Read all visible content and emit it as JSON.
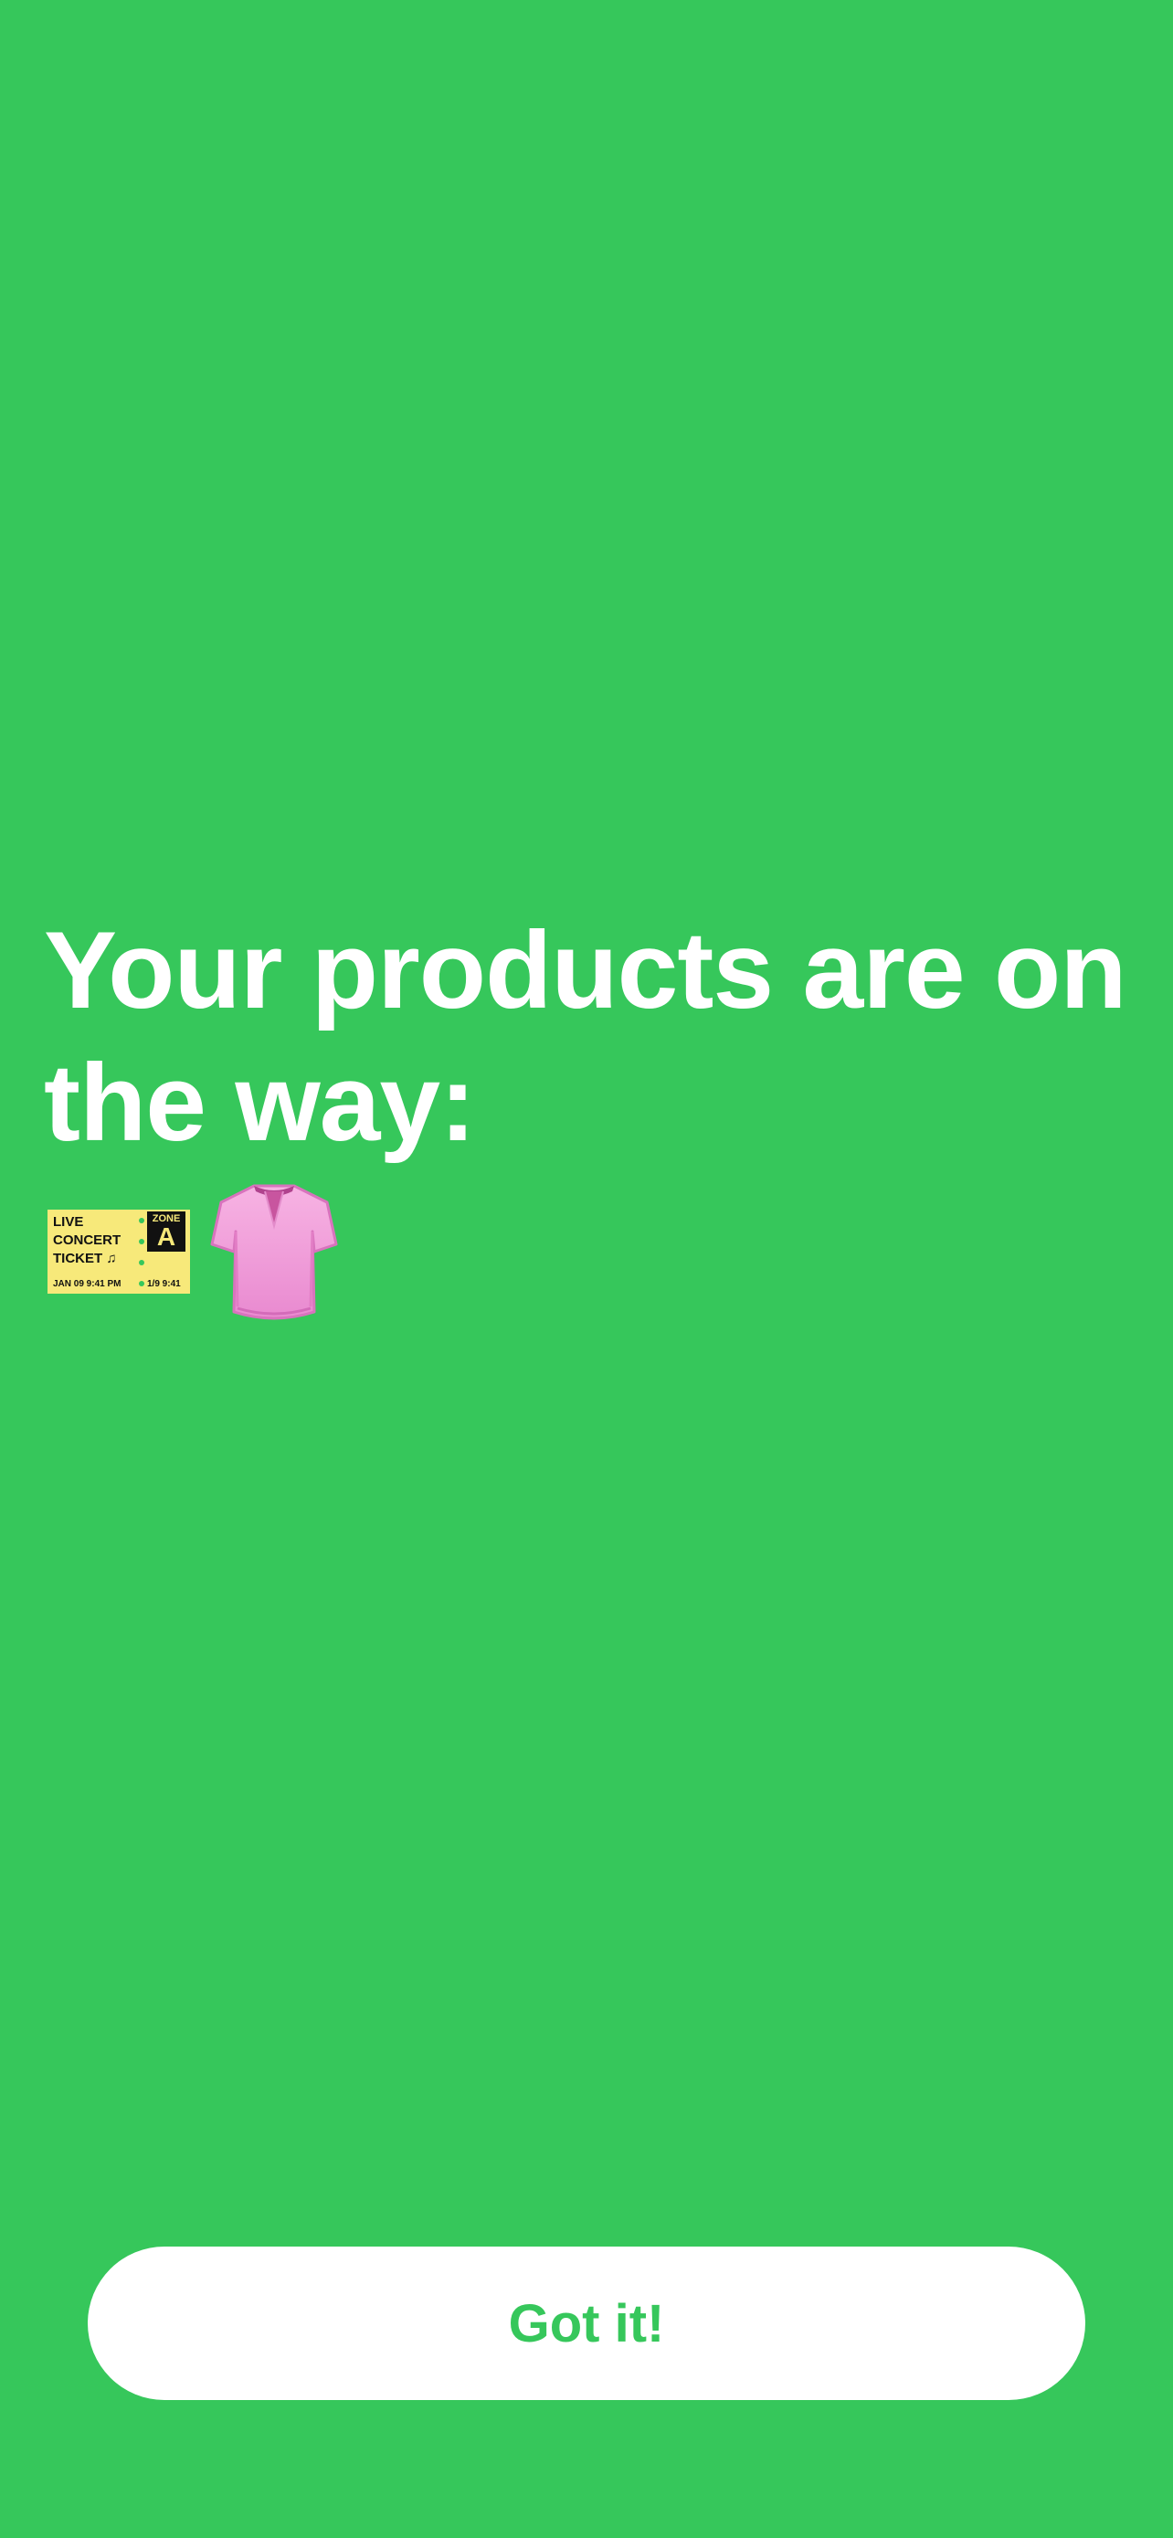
{
  "headline": {
    "line1": "Your products are on",
    "line2": "the way:"
  },
  "products": [
    {
      "icon": "concert-ticket-icon",
      "ticket_lines": [
        "LIVE",
        "CONCERT",
        "TICKET ♫"
      ],
      "ticket_footer": "JAN 09   9:41 PM",
      "zone_label": "ZONE",
      "zone_value": "A",
      "stub_footer": "1/9  9:41"
    },
    {
      "icon": "blouse-icon"
    }
  ],
  "button": {
    "label": "Got it!"
  },
  "colors": {
    "background": "#36c75b",
    "text": "#ffffff",
    "button_background": "#ffffff",
    "button_text": "#36c75b",
    "ticket": "#f7e97a",
    "blouse": "#f3a0d8"
  }
}
